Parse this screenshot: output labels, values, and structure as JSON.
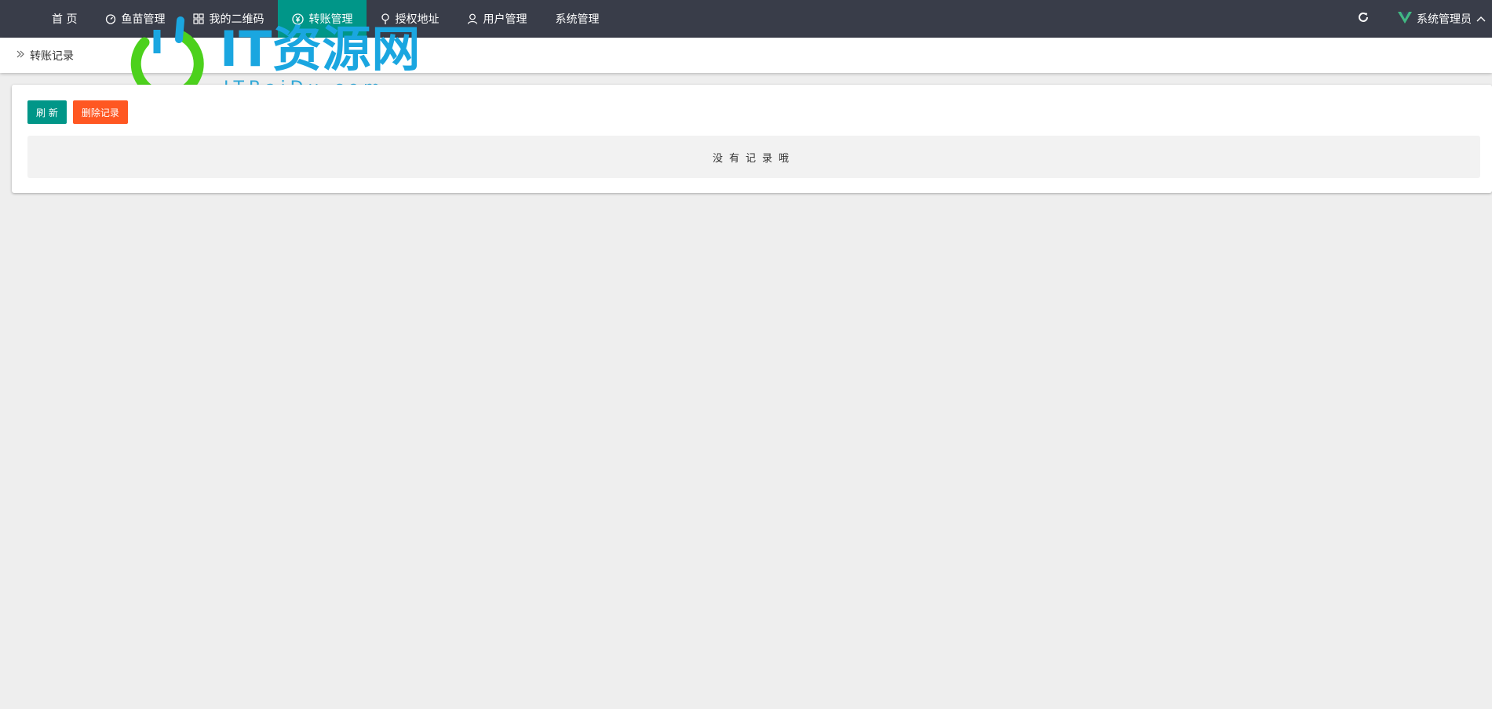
{
  "nav": {
    "items": [
      {
        "label": "首 页",
        "icon": "",
        "active": false
      },
      {
        "label": "鱼苗管理",
        "icon": "timer-icon",
        "active": false
      },
      {
        "label": "我的二维码",
        "icon": "grid-icon",
        "active": false
      },
      {
        "label": "转账管理",
        "icon": "yen-icon",
        "active": true
      },
      {
        "label": "授权地址",
        "icon": "pin-icon",
        "active": false
      },
      {
        "label": "用户管理",
        "icon": "user-icon",
        "active": false
      },
      {
        "label": "系统管理",
        "icon": "",
        "active": false
      }
    ],
    "refresh_icon": "refresh-icon",
    "user_name": "系统管理员",
    "user_icon": "vue-logo-icon"
  },
  "breadcrumb": {
    "label": "转账记录",
    "icon": "double-chevron-right-icon"
  },
  "watermark": {
    "title": "IT资源网",
    "subtitle": "ITBaiDu.com"
  },
  "toolbar": {
    "refresh_label": "刷 新",
    "delete_label": "删除记录"
  },
  "empty_text": "没有记录哦",
  "colors": {
    "topbar": "#393d49",
    "accent": "#009688",
    "danger": "#ff5722"
  }
}
